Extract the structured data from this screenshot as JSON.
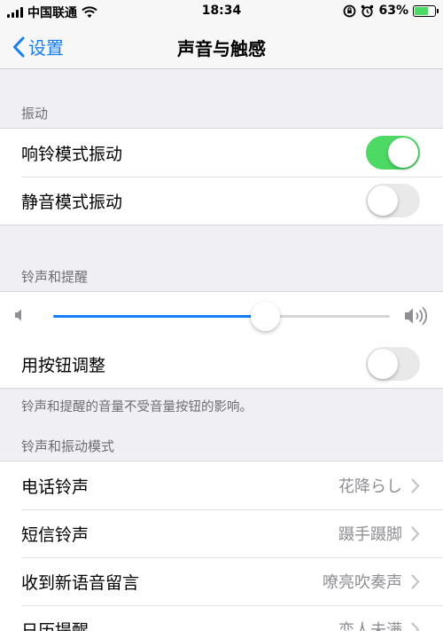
{
  "status_bar": {
    "carrier": "中国联通",
    "time": "18:34",
    "battery_percent": "63%"
  },
  "nav": {
    "back_label": "设置",
    "title": "声音与触感"
  },
  "vibration": {
    "header": "振动",
    "ring_vibrate_label": "响铃模式振动",
    "ring_vibrate_on": true,
    "silent_vibrate_label": "静音模式振动",
    "silent_vibrate_on": false
  },
  "ringer": {
    "header": "铃声和提醒",
    "volume_level": 0.63,
    "change_with_buttons_label": "用按钮调整",
    "change_with_buttons_on": false,
    "footer": "铃声和提醒的音量不受音量按钮的影响。"
  },
  "patterns": {
    "header": "铃声和振动模式",
    "items": [
      {
        "label": "电话铃声",
        "value": "花降らし"
      },
      {
        "label": "短信铃声",
        "value": "蹑手蹑脚"
      },
      {
        "label": "收到新语音留言",
        "value": "嘹亮吹奏声"
      },
      {
        "label": "日历提醒",
        "value": "恋人未满"
      }
    ]
  }
}
